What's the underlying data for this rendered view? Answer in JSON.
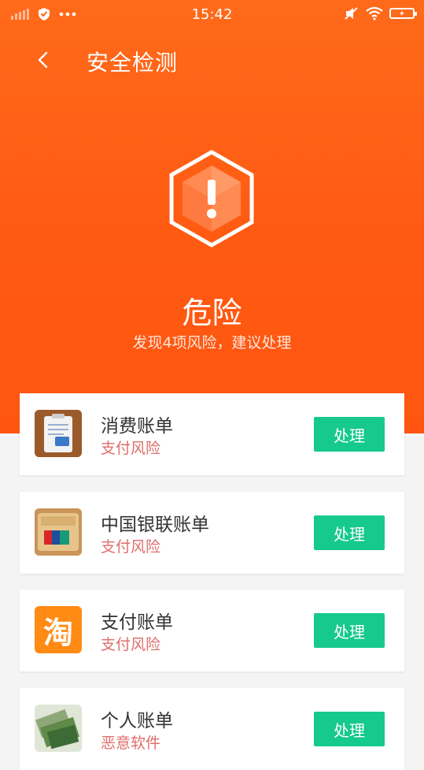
{
  "status_bar": {
    "time": "15:42"
  },
  "header": {
    "title": "安全检测"
  },
  "summary": {
    "status": "危险",
    "description": "发现4项风险，建议处理"
  },
  "risks": [
    {
      "name": "消费账单",
      "risk": "支付风险",
      "action": "处理",
      "icon": "bill-app-icon"
    },
    {
      "name": "中国银联账单",
      "risk": "支付风险",
      "action": "处理",
      "icon": "unionpay-app-icon"
    },
    {
      "name": "支付账单",
      "risk": "支付风险",
      "action": "处理",
      "icon": "taobao-app-icon",
      "icon_char": "淘"
    },
    {
      "name": "个人账单",
      "risk": "恶意软件",
      "action": "处理",
      "icon": "money-app-icon"
    }
  ],
  "colors": {
    "accent": "#ff5a12",
    "action": "#16c98d",
    "risk": "#d9534f"
  }
}
